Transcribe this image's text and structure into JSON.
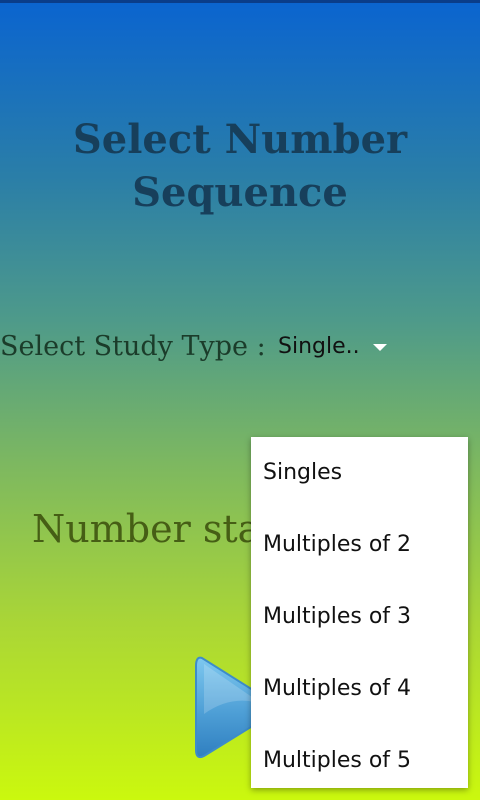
{
  "page": {
    "title": "Select Number Sequence",
    "study_type_label": "Select Study Type :",
    "number_start_label": "Number sta"
  },
  "spinner": {
    "selected_value": "Single.."
  },
  "dropdown": {
    "options": [
      "Singles",
      "Multiples of 2",
      "Multiples of 3",
      "Multiples of 4",
      "Multiples of 5"
    ]
  },
  "play_button": {
    "icon": "play-icon",
    "color": "#5aaee0"
  }
}
